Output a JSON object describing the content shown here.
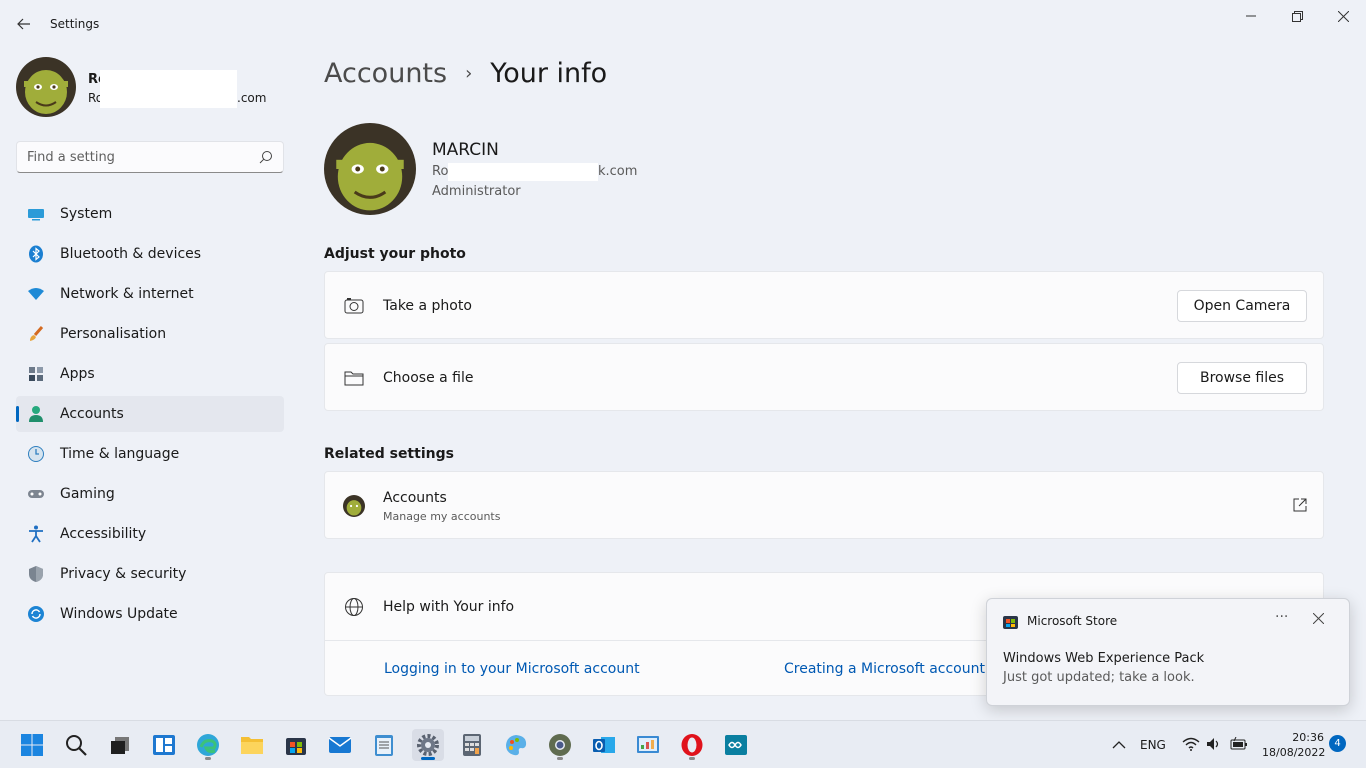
{
  "window": {
    "title": "Settings",
    "back_icon": "back-arrow-icon",
    "controls": [
      "minimize-icon",
      "maximize-icon",
      "close-icon"
    ]
  },
  "sidebar": {
    "profile": {
      "name": "Ro",
      "email_start": "Ro",
      "email_end": ".com"
    },
    "search": {
      "placeholder": "Find a setting"
    },
    "items": [
      {
        "label": "System",
        "icon": "monitor-icon"
      },
      {
        "label": "Bluetooth & devices",
        "icon": "bluetooth-icon"
      },
      {
        "label": "Network & internet",
        "icon": "wifi-icon"
      },
      {
        "label": "Personalisation",
        "icon": "brush-icon"
      },
      {
        "label": "Apps",
        "icon": "apps-icon"
      },
      {
        "label": "Accounts",
        "icon": "person-icon",
        "active": true
      },
      {
        "label": "Time & language",
        "icon": "clock-globe-icon"
      },
      {
        "label": "Gaming",
        "icon": "gamepad-icon"
      },
      {
        "label": "Accessibility",
        "icon": "accessibility-icon"
      },
      {
        "label": "Privacy & security",
        "icon": "shield-icon"
      },
      {
        "label": "Windows Update",
        "icon": "update-icon"
      }
    ]
  },
  "main": {
    "breadcrumb": {
      "parent": "Accounts",
      "separator": "›",
      "current": "Your info"
    },
    "user": {
      "name": "MARCIN",
      "email_start": "Ro",
      "email_end": "k.com",
      "role": "Administrator"
    },
    "adjust_photo": {
      "title": "Adjust your photo",
      "take_photo": {
        "label": "Take a photo",
        "button": "Open Camera",
        "icon": "camera-icon"
      },
      "choose_file": {
        "label": "Choose a file",
        "button": "Browse files",
        "icon": "folder-icon"
      }
    },
    "related": {
      "title": "Related settings",
      "accounts": {
        "label": "Accounts",
        "sublabel": "Manage my accounts",
        "icon": "external-link-icon"
      }
    },
    "help": {
      "label": "Help with Your info",
      "icon": "globe-icon",
      "links": [
        "Logging in to your Microsoft account",
        "Creating a Microsoft account"
      ]
    }
  },
  "toast": {
    "app": "Microsoft Store",
    "more": "···",
    "title": "Windows Web Experience Pack",
    "body": "Just got updated; take a look."
  },
  "taskbar": {
    "apps": [
      "start-icon",
      "search-icon",
      "task-view-icon",
      "widgets-icon",
      "edge-icon",
      "file-explorer-icon",
      "store-icon",
      "mail-icon",
      "notepad-icon",
      "settings-icon",
      "calculator-icon",
      "paint-icon",
      "chrome-icon",
      "outlook-icon",
      "control-panel-icon",
      "opera-icon",
      "arduino-icon"
    ],
    "tray": {
      "language": "ENG",
      "time": "20:36",
      "date": "18/08/2022",
      "notifications": "4"
    }
  },
  "colors": {
    "accent": "#0067c0",
    "link": "#0059b3",
    "background": "#eef1f7",
    "card": "#fbfbfc"
  }
}
